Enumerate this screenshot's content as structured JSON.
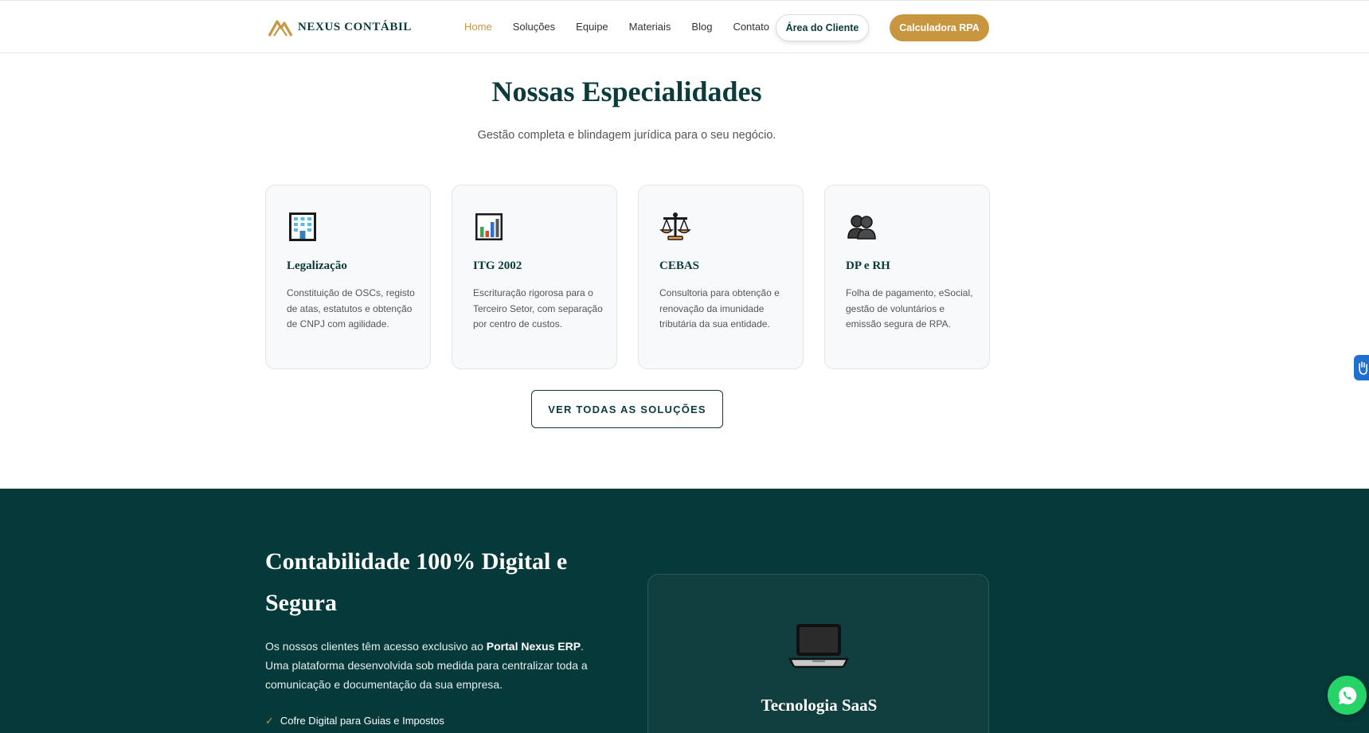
{
  "header": {
    "logo_text": "NEXUS CONTÁBIL",
    "nav": [
      "Home",
      "Soluções",
      "Equipe",
      "Materiais",
      "Blog",
      "Contato"
    ],
    "active_nav": "Home",
    "client_button": "Área do Cliente",
    "calc_button": "Calculadora RPA"
  },
  "specialties": {
    "title": "Nossas Especialidades",
    "subtitle": "Gestão completa e blindagem jurídica para o seu negócio.",
    "cards": [
      {
        "icon": "office-building-icon",
        "title": "Legalização",
        "description": "Constituição de OSCs, registo de atas, estatutos e obtenção de CNPJ com agilidade."
      },
      {
        "icon": "bar-chart-icon",
        "title": "ITG 2002",
        "description": "Escrituração rigorosa para o Terceiro Setor, com separação por centro de custos."
      },
      {
        "icon": "scales-icon",
        "title": "CEBAS",
        "description": "Consultoria para obtenção e renovação da imunidade tributária da sua entidade."
      },
      {
        "icon": "people-icon",
        "title": "DP e RH",
        "description": "Folha de pagamento, eSocial, gestão de voluntários e emissão segura de RPA."
      }
    ],
    "all_button": "VER TODAS AS SOLUÇÕES"
  },
  "digital": {
    "title": "Contabilidade 100% Digital e Segura",
    "text_before": "Os nossos clientes têm acesso exclusivo ao ",
    "text_bold": "Portal Nexus ERP",
    "text_after": ". Uma plataforma desenvolvida sob medida para centralizar toda a comunicação e documentação da sua empresa.",
    "check_mark": "✓",
    "check_item": "Cofre Digital para Guias e Impostos",
    "card_title": "Tecnologia SaaS"
  },
  "colors": {
    "brand_dark": "#05393a",
    "accent_gold": "#c8963e",
    "whatsapp_green": "#25d366"
  }
}
